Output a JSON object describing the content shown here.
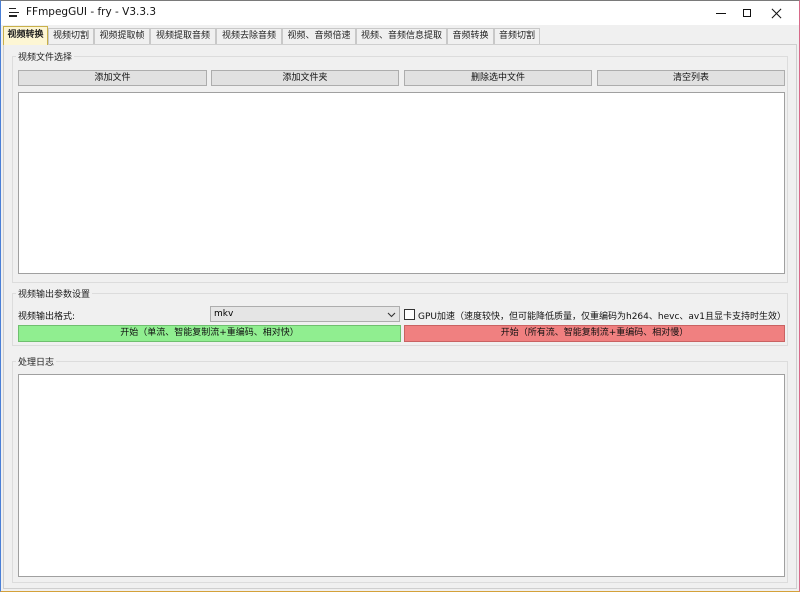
{
  "window": {
    "title": "FFmpegGUI - fry - V3.3.3",
    "controls": [
      "minimize",
      "maximize",
      "close"
    ]
  },
  "tabs": [
    {
      "label": "视频转换",
      "active": true
    },
    {
      "label": "视频切割",
      "active": false
    },
    {
      "label": "视频提取帧",
      "active": false
    },
    {
      "label": "视频提取音频",
      "active": false
    },
    {
      "label": "视频去除音频",
      "active": false
    },
    {
      "label": "视频、音频倍速",
      "active": false
    },
    {
      "label": "视频、音频信息提取",
      "active": false
    },
    {
      "label": "音频转换",
      "active": false
    },
    {
      "label": "音频切割",
      "active": false
    }
  ],
  "file_select": {
    "title": "视频文件选择",
    "add_file": "添加文件",
    "add_folder": "添加文件夹",
    "delete_selected": "删除选中文件",
    "clear_list": "清空列表"
  },
  "output_settings": {
    "title": "视频输出参数设置",
    "format_label": "视频输出格式:",
    "format_value": "mkv",
    "gpu_label": "GPU加速（速度较快，但可能降低质量，仅重编码为h264、hevc、av1且显卡支持时生效）",
    "gpu_checked": false,
    "start_single": "开始（单流、智能复制流+重编码、相对快）",
    "start_all": "开始（所有流、智能复制流+重编码、相对慢）"
  },
  "log": {
    "title": "处理日志"
  },
  "colors": {
    "start_single_bg": "#90ee90",
    "start_all_bg": "#f08080",
    "active_tab_bg": "#fdf6d4"
  }
}
